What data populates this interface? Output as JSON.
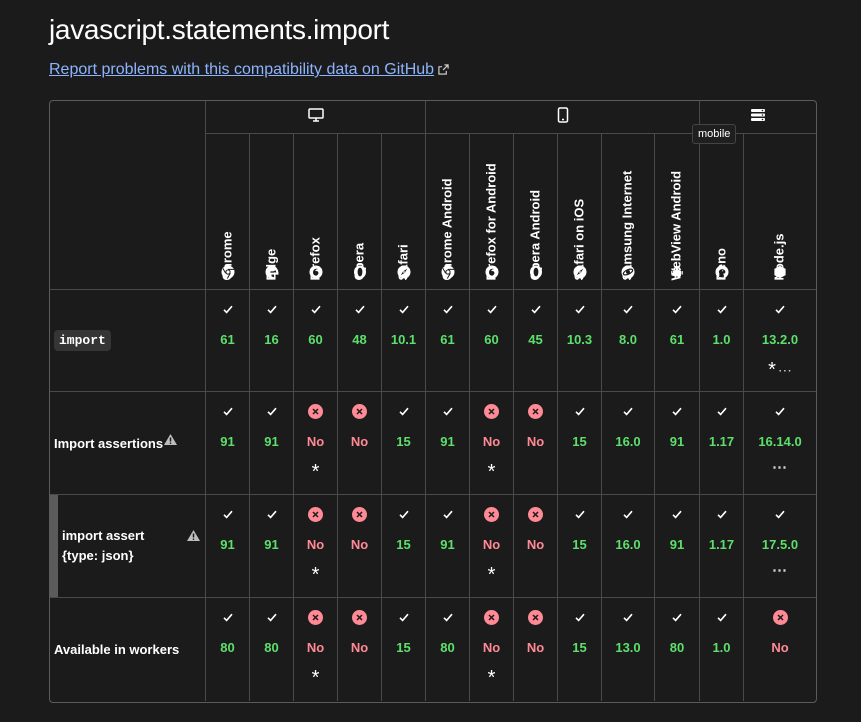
{
  "page": {
    "title": "javascript.statements.import",
    "report_link": "Report problems with this compatibility data on GitHub"
  },
  "groups": [
    {
      "id": "desktop",
      "icon": "desktop-icon",
      "cols": 5
    },
    {
      "id": "mobile",
      "icon": "mobile-icon",
      "cols": 6
    },
    {
      "id": "server",
      "icon": "server-icon",
      "cols": 2
    }
  ],
  "tooltip": "mobile",
  "browsers": [
    {
      "name": "Chrome",
      "icon": "chrome-icon"
    },
    {
      "name": "Edge",
      "icon": "edge-icon"
    },
    {
      "name": "Firefox",
      "icon": "firefox-icon"
    },
    {
      "name": "Opera",
      "icon": "opera-icon"
    },
    {
      "name": "Safari",
      "icon": "safari-icon"
    },
    {
      "name": "Chrome Android",
      "icon": "chrome-icon"
    },
    {
      "name": "Firefox for Android",
      "icon": "firefox-icon"
    },
    {
      "name": "Opera Android",
      "icon": "opera-icon"
    },
    {
      "name": "Safari on iOS",
      "icon": "safari-icon"
    },
    {
      "name": "Samsung Internet",
      "icon": "samsung-icon"
    },
    {
      "name": "WebView Android",
      "icon": "android-icon"
    },
    {
      "name": "Deno",
      "icon": "deno-icon"
    },
    {
      "name": "Node.js",
      "icon": "nodejs-icon"
    }
  ],
  "features": [
    {
      "label": "import",
      "style": "code",
      "warning": false,
      "sub": false,
      "support": [
        {
          "s": "yes",
          "v": "61"
        },
        {
          "s": "yes",
          "v": "16"
        },
        {
          "s": "yes",
          "v": "60"
        },
        {
          "s": "yes",
          "v": "48"
        },
        {
          "s": "yes",
          "v": "10.1"
        },
        {
          "s": "yes",
          "v": "61"
        },
        {
          "s": "yes",
          "v": "60"
        },
        {
          "s": "yes",
          "v": "45"
        },
        {
          "s": "yes",
          "v": "10.3"
        },
        {
          "s": "yes",
          "v": "8.0"
        },
        {
          "s": "yes",
          "v": "61"
        },
        {
          "s": "yes",
          "v": "1.0"
        },
        {
          "s": "yes",
          "v": "13.2.0",
          "note": "*",
          "more": "⋯"
        }
      ]
    },
    {
      "label": "Import assertions",
      "style": "bold",
      "warning": true,
      "sub": false,
      "support": [
        {
          "s": "yes",
          "v": "91"
        },
        {
          "s": "yes",
          "v": "91"
        },
        {
          "s": "no",
          "v": "No",
          "note": "*"
        },
        {
          "s": "no",
          "v": "No"
        },
        {
          "s": "yes",
          "v": "15"
        },
        {
          "s": "yes",
          "v": "91"
        },
        {
          "s": "no",
          "v": "No",
          "note": "*"
        },
        {
          "s": "no",
          "v": "No"
        },
        {
          "s": "yes",
          "v": "15"
        },
        {
          "s": "yes",
          "v": "16.0"
        },
        {
          "s": "yes",
          "v": "91"
        },
        {
          "s": "yes",
          "v": "1.17"
        },
        {
          "s": "yes",
          "v": "16.14.0",
          "more": "⋯"
        }
      ]
    },
    {
      "label": "import assert\n{type: json}",
      "style": "bold",
      "warning": true,
      "sub": true,
      "support": [
        {
          "s": "yes",
          "v": "91"
        },
        {
          "s": "yes",
          "v": "91"
        },
        {
          "s": "no",
          "v": "No",
          "note": "*"
        },
        {
          "s": "no",
          "v": "No"
        },
        {
          "s": "yes",
          "v": "15"
        },
        {
          "s": "yes",
          "v": "91"
        },
        {
          "s": "no",
          "v": "No",
          "note": "*"
        },
        {
          "s": "no",
          "v": "No"
        },
        {
          "s": "yes",
          "v": "15"
        },
        {
          "s": "yes",
          "v": "16.0"
        },
        {
          "s": "yes",
          "v": "91"
        },
        {
          "s": "yes",
          "v": "1.17"
        },
        {
          "s": "yes",
          "v": "17.5.0",
          "more": "⋯"
        }
      ]
    },
    {
      "label": "Available in workers",
      "style": "bold",
      "warning": false,
      "sub": false,
      "support": [
        {
          "s": "yes",
          "v": "80"
        },
        {
          "s": "yes",
          "v": "80"
        },
        {
          "s": "no",
          "v": "No",
          "note": "*"
        },
        {
          "s": "no",
          "v": "No"
        },
        {
          "s": "yes",
          "v": "15"
        },
        {
          "s": "yes",
          "v": "80"
        },
        {
          "s": "no",
          "v": "No",
          "note": "*"
        },
        {
          "s": "no",
          "v": "No"
        },
        {
          "s": "yes",
          "v": "15"
        },
        {
          "s": "yes",
          "v": "13.0"
        },
        {
          "s": "yes",
          "v": "80"
        },
        {
          "s": "yes",
          "v": "1.0"
        },
        {
          "s": "no",
          "v": "No"
        }
      ]
    }
  ],
  "colors": {
    "yes": "#5ce06b",
    "no": "#ff8a95",
    "link": "#8cb4ff"
  }
}
